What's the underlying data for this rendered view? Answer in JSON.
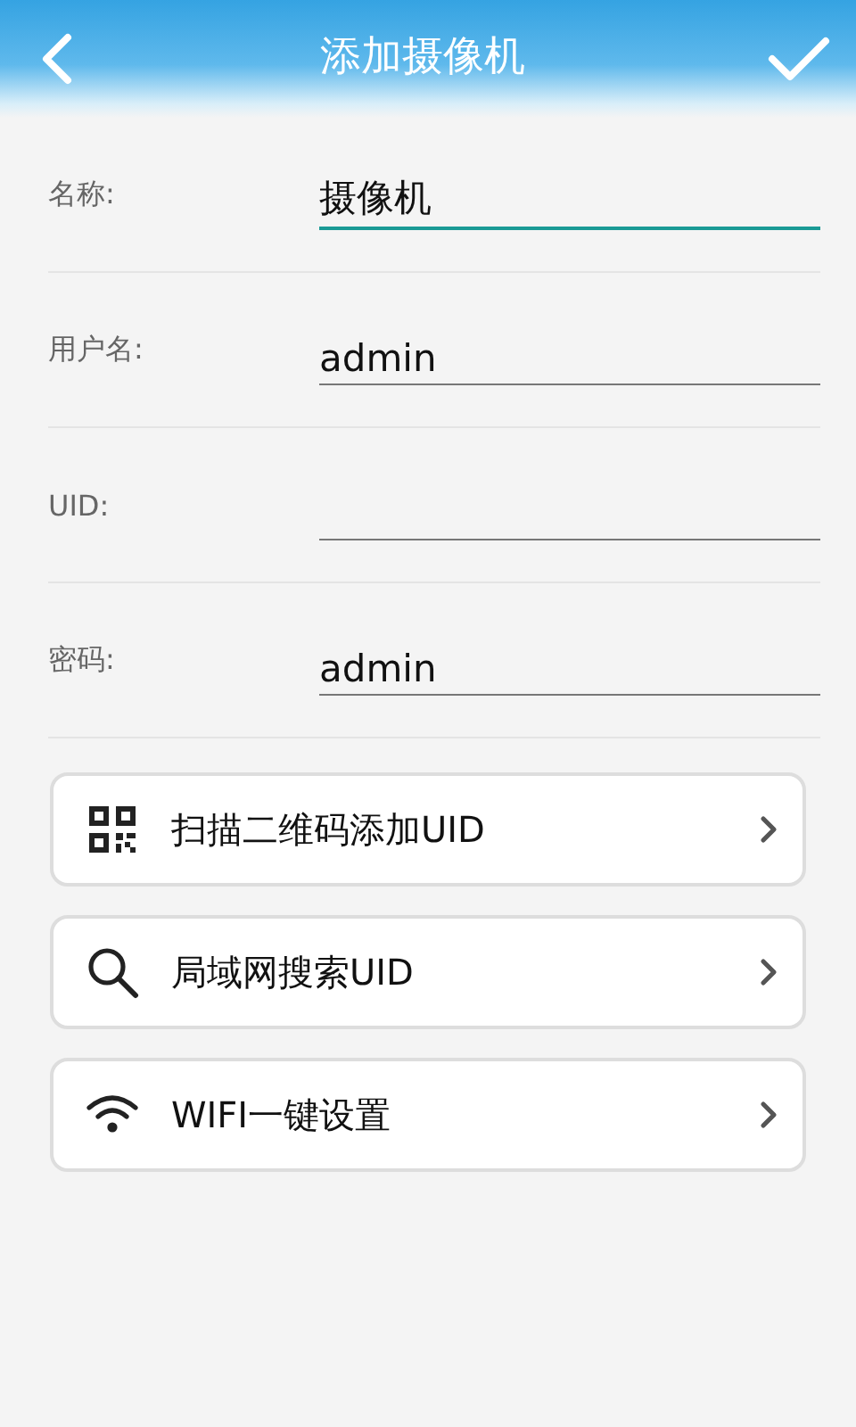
{
  "header": {
    "title": "添加摄像机"
  },
  "fields": [
    {
      "label": "名称:",
      "value": "摄像机",
      "focused": true
    },
    {
      "label": "用户名:",
      "value": "admin",
      "focused": false
    },
    {
      "label": "UID:",
      "focused": false
    },
    {
      "label": "密码:",
      "value": "admin",
      "focused": false
    }
  ],
  "actions": [
    {
      "kind": "qr",
      "label": "扫描二维码添加UID"
    },
    {
      "kind": "search",
      "label": "局域网搜索UID"
    },
    {
      "kind": "wifi",
      "label": "WIFI一键设置"
    }
  ]
}
